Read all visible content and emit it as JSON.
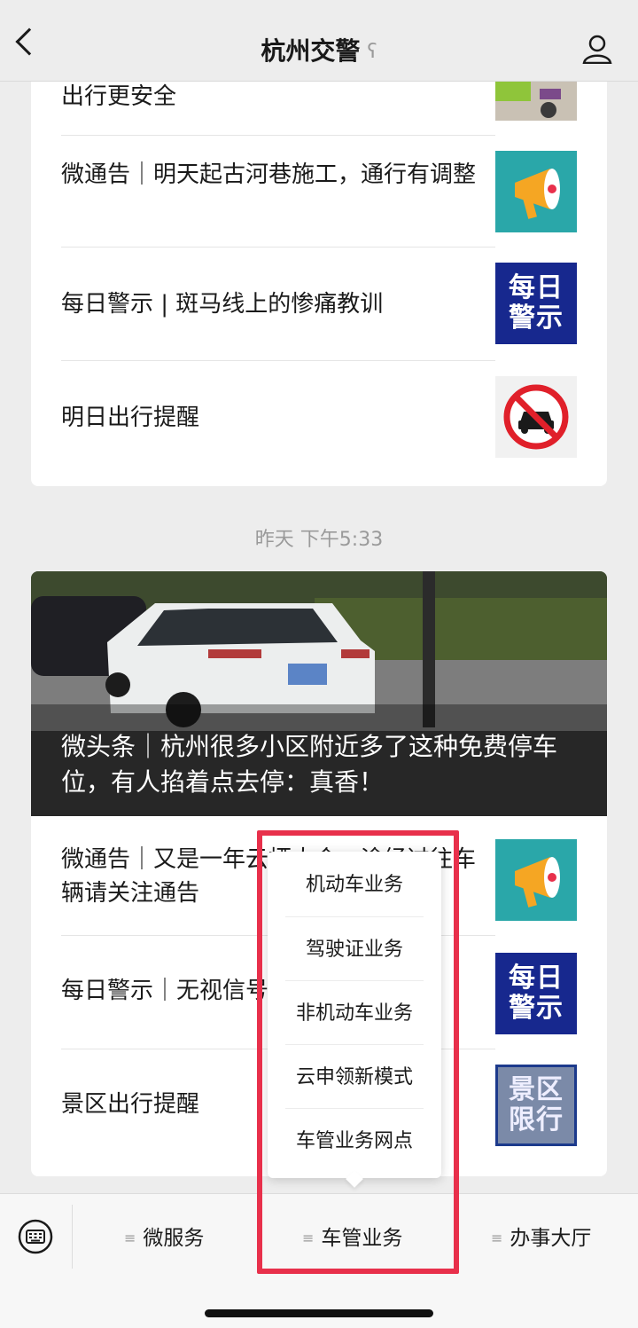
{
  "header": {
    "title": "杭州交警",
    "back_icon": "chevron-left-icon",
    "ear_icon": "ear-icon",
    "profile_icon": "profile-icon"
  },
  "card1": {
    "partial_title": "出行更安全",
    "items": [
      {
        "title": "微通告｜明天起古河巷施工，通行有调整",
        "thumb": "megaphone-icon"
      },
      {
        "title": "每日警示 | 斑马线上的惨痛教训",
        "thumb": "daily-warning-badge",
        "badge_text": "每日警示"
      },
      {
        "title": "明日出行提醒",
        "thumb": "no-car-sign-icon"
      }
    ]
  },
  "timestamp": "昨天 下午5:33",
  "card2": {
    "hero_title": "微头条｜杭州很多小区附近多了这种免费停车位，有人掐着点去停：真香！",
    "items": [
      {
        "title": "微通告｜又是一年云栖大会，途经过往车辆请关注通告",
        "thumb": "megaphone-icon"
      },
      {
        "title": "每日警示｜无视信号灯",
        "thumb": "daily-warning-badge",
        "badge_text": "每日警示"
      },
      {
        "title": "景区出行提醒",
        "thumb": "scenic-limit-badge",
        "badge_text": "景区限行"
      }
    ]
  },
  "popup_menu": {
    "items": [
      "机动车业务",
      "驾驶证业务",
      "非机动车业务",
      "云申领新模式",
      "车管业务网点"
    ]
  },
  "bottom_menu": {
    "keyboard_icon": "keyboard-icon",
    "tabs": [
      "微服务",
      "车管业务",
      "办事大厅"
    ]
  },
  "colors": {
    "highlight": "#e8304b",
    "badge_blue": "#17288e",
    "megaphone_bg": "#2aa7a9"
  }
}
